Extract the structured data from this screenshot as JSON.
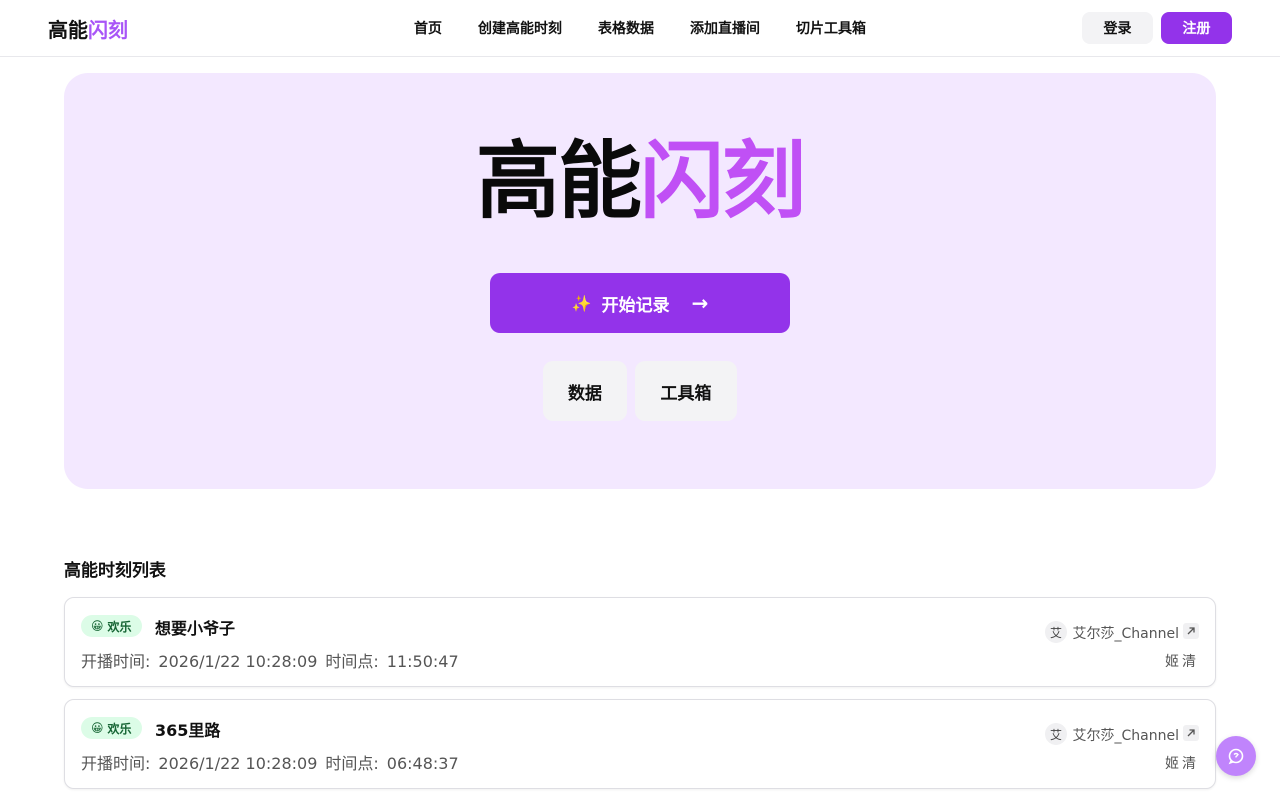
{
  "nav": {
    "logo_a": "高能",
    "logo_b": "闪刻",
    "menu": [
      "首页",
      "创建高能时刻",
      "表格数据",
      "添加直播间",
      "切片工具箱"
    ],
    "login": "登录",
    "register": "注册"
  },
  "hero": {
    "title_a": "高能",
    "title_b": "闪刻",
    "cta_icon": "✨",
    "cta_label": "开始记录",
    "cta_arrow": "→",
    "data_button": "数据",
    "tools_button": "工具箱"
  },
  "list": {
    "title": "高能时刻列表",
    "items": [
      {
        "tag_emoji": "😀",
        "tag": "欢乐",
        "title": "想要小爷子",
        "start_label": "开播时间:",
        "start": "2026/1/22 10:28:09",
        "point_label": "时间点:",
        "point": "11:50:47",
        "avatar": "艾",
        "channel": "艾尔莎_Channel",
        "author": "姬清"
      },
      {
        "tag_emoji": "😀",
        "tag": "欢乐",
        "title": "365里路",
        "start_label": "开播时间:",
        "start": "2026/1/22 10:28:09",
        "point_label": "时间点:",
        "point": "06:48:37",
        "avatar": "艾",
        "channel": "艾尔莎_Channel",
        "author": "姬清"
      }
    ]
  },
  "colors": {
    "brand": "#9333ea",
    "accent": "#c050f5",
    "hero_bg": "#f3e8ff",
    "tag_bg": "#dcfce7"
  },
  "icons": {
    "external_link": "external-link-icon",
    "chat": "chat-bubble-icon"
  }
}
